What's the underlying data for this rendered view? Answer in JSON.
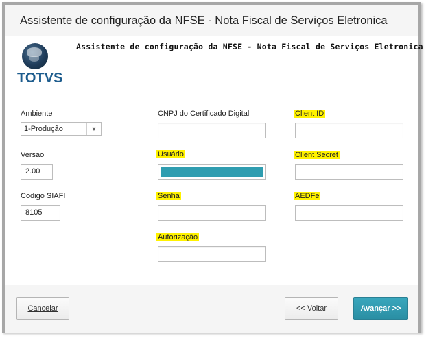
{
  "window": {
    "title": "Assistente de configuração da NFSE - Nota Fiscal de Serviços Eletronica"
  },
  "header": {
    "text": "Assistente de configuração da NFSE - Nota Fiscal de Serviços Eletronica"
  },
  "logo": {
    "text": "TOTVS"
  },
  "form": {
    "ambiente": {
      "label": "Ambiente",
      "value": "1-Produção"
    },
    "versao": {
      "label": "Versao",
      "value": "2.00"
    },
    "codigo_siafi": {
      "label": "Codigo SIAFI",
      "value": "8105"
    },
    "cnpj": {
      "label": "CNPJ do Certificado Digital",
      "value": ""
    },
    "usuario": {
      "label": "Usuário",
      "value": ""
    },
    "senha": {
      "label": "Senha",
      "value": ""
    },
    "autorizacao": {
      "label": "Autorização",
      "value": ""
    },
    "client_id": {
      "label": "Client ID",
      "value": ""
    },
    "client_secret": {
      "label": "Client Secret",
      "value": ""
    },
    "aedfe": {
      "label": "AEDFe",
      "value": ""
    }
  },
  "buttons": {
    "cancel_label": "Cancelar",
    "back_label": "<< Voltar",
    "next_label": "Avançar >>"
  },
  "colors": {
    "accent": "#2f9db0",
    "highlight": "#fff200",
    "logo": "#1e5d8e"
  }
}
